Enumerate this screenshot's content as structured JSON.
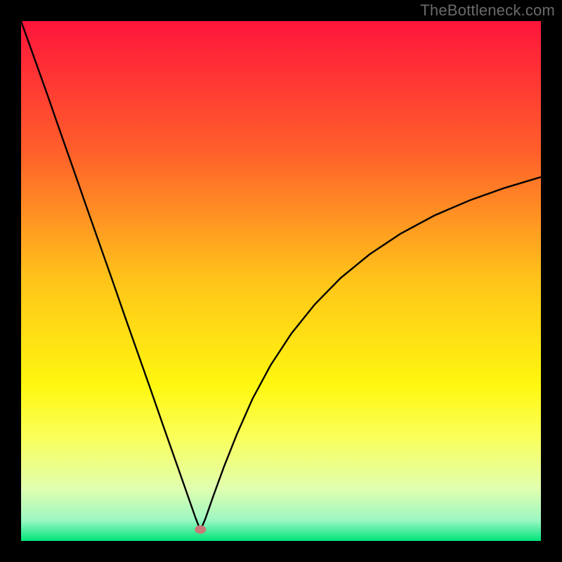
{
  "watermark": "TheBottleneck.com",
  "chart_data": {
    "type": "line",
    "title": "",
    "xlabel": "",
    "ylabel": "",
    "xlim": [
      0,
      100
    ],
    "ylim": [
      0,
      100
    ],
    "background_gradient": {
      "stops": [
        {
          "offset": 0.0,
          "color": "#ff153b"
        },
        {
          "offset": 0.25,
          "color": "#ff5f2b"
        },
        {
          "offset": 0.5,
          "color": "#ffc51a"
        },
        {
          "offset": 0.7,
          "color": "#fff70f"
        },
        {
          "offset": 0.8,
          "color": "#faff5a"
        },
        {
          "offset": 0.9,
          "color": "#e0ffb0"
        },
        {
          "offset": 0.96,
          "color": "#9cf7c2"
        },
        {
          "offset": 1.0,
          "color": "#00e47a"
        }
      ]
    },
    "marker": {
      "x": 34.5,
      "y": 2.2,
      "color": "#c97a78"
    },
    "series": [
      {
        "name": "curve",
        "color": "#000000",
        "x": [
          0.0,
          2.5,
          5.0,
          7.5,
          10.0,
          12.5,
          15.0,
          17.5,
          20.0,
          22.5,
          25.0,
          27.5,
          30.0,
          32.0,
          33.5,
          34.5,
          35.5,
          37.0,
          39.0,
          41.5,
          44.5,
          48.0,
          52.0,
          56.5,
          61.5,
          67.0,
          73.0,
          79.5,
          86.5,
          93.0,
          100.0
        ],
        "y": [
          100.0,
          93.0,
          86.0,
          78.8,
          71.7,
          64.5,
          57.4,
          50.3,
          43.1,
          36.0,
          28.9,
          21.7,
          14.6,
          8.9,
          4.6,
          2.0,
          4.4,
          8.7,
          14.2,
          20.5,
          27.3,
          33.8,
          39.9,
          45.5,
          50.6,
          55.1,
          59.1,
          62.6,
          65.6,
          67.9,
          70.0
        ]
      }
    ]
  }
}
